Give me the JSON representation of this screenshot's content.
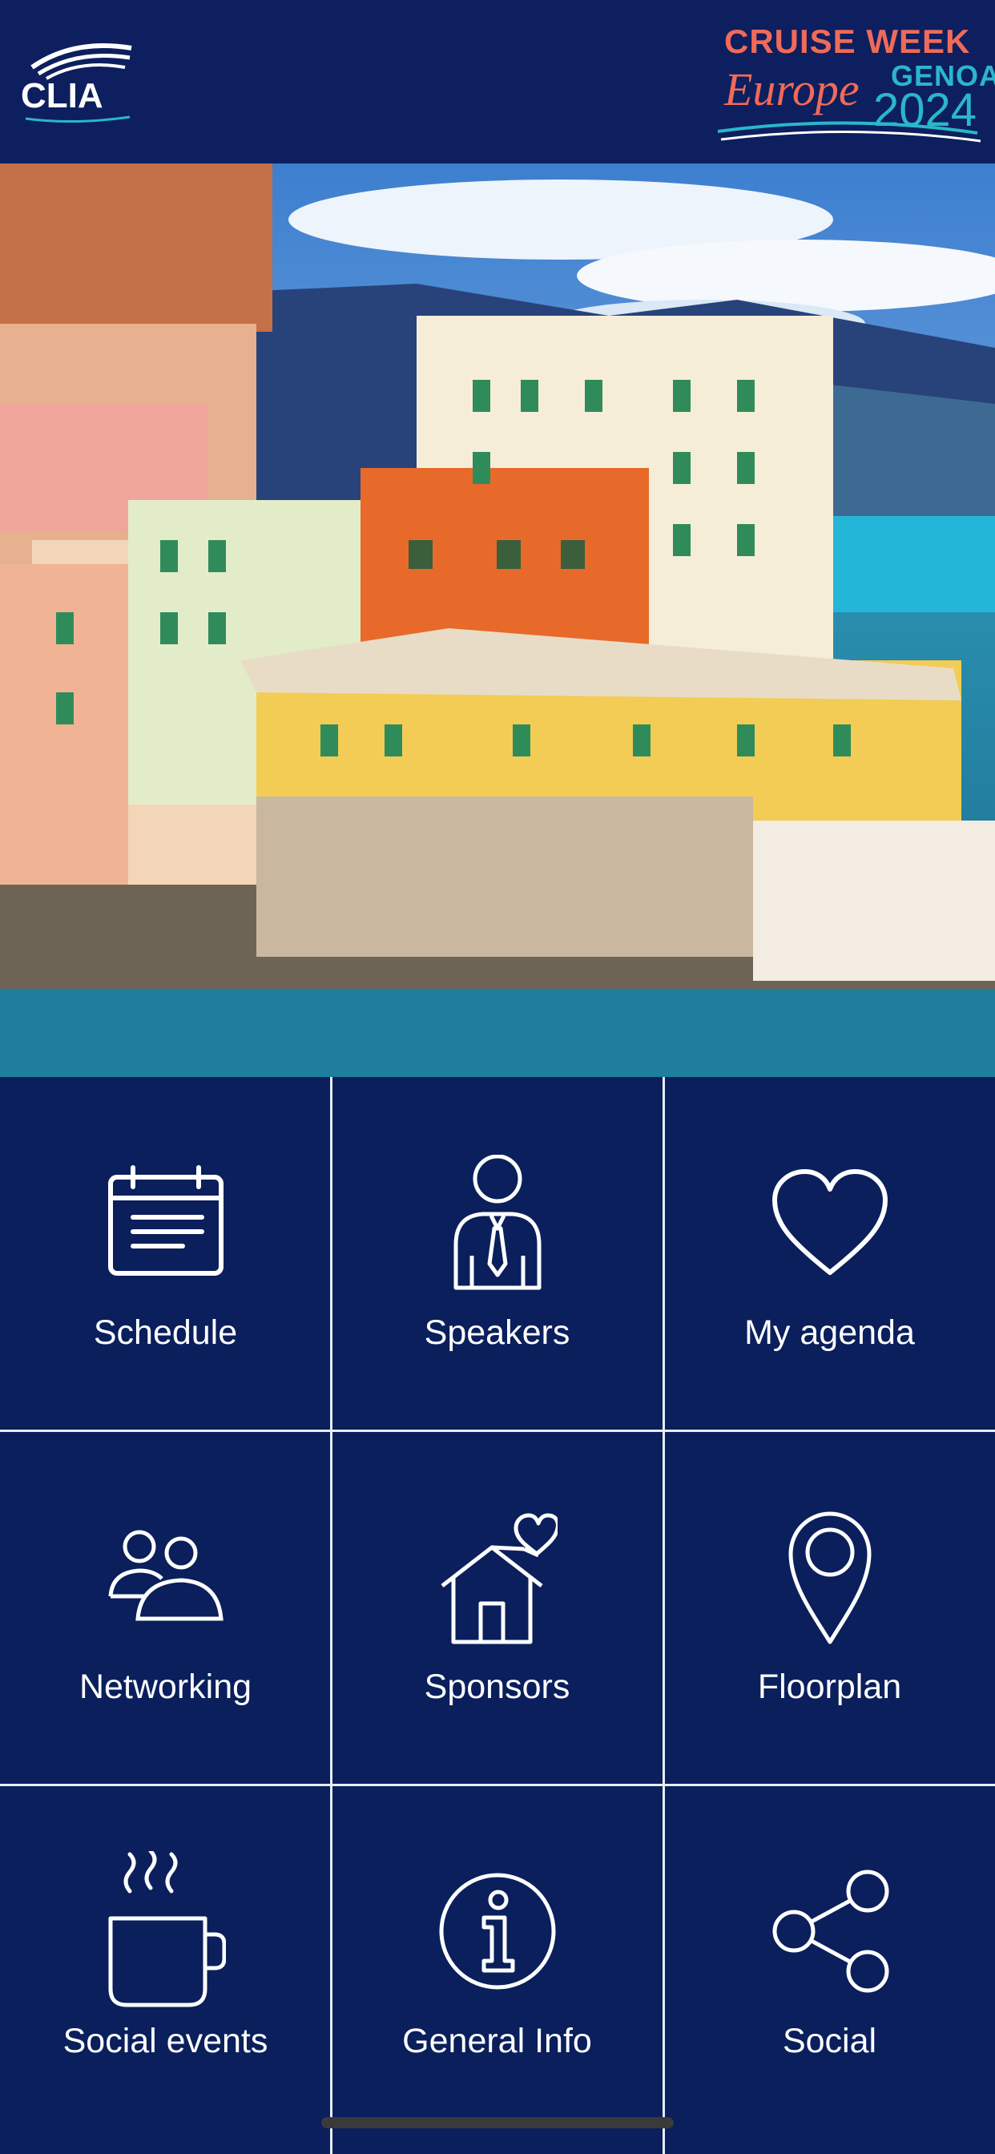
{
  "header": {
    "left_logo": "CLIA",
    "right_logo": {
      "line1": "CRUISE WEEK",
      "line2": "Europe",
      "line3": "GENOA",
      "line4": "2024"
    }
  },
  "hero": {
    "image": "colorful-seaside-buildings-genoa"
  },
  "menu": [
    {
      "label": "Schedule",
      "icon": "calendar-icon"
    },
    {
      "label": "Speakers",
      "icon": "speaker-person-icon"
    },
    {
      "label": "My agenda",
      "icon": "heart-icon"
    },
    {
      "label": "Networking",
      "icon": "people-icon"
    },
    {
      "label": "Sponsors",
      "icon": "house-heart-icon"
    },
    {
      "label": "Floorplan",
      "icon": "map-pin-icon"
    },
    {
      "label": "Social events",
      "icon": "coffee-cup-icon"
    },
    {
      "label": "General Info",
      "icon": "info-icon"
    },
    {
      "label": "Social",
      "icon": "share-icon"
    }
  ],
  "colors": {
    "background": "#0a1f5c",
    "header": "#0d1f5e",
    "divider": "#e8ecf5",
    "coral": "#f06a5a",
    "teal": "#2ab7c9"
  }
}
